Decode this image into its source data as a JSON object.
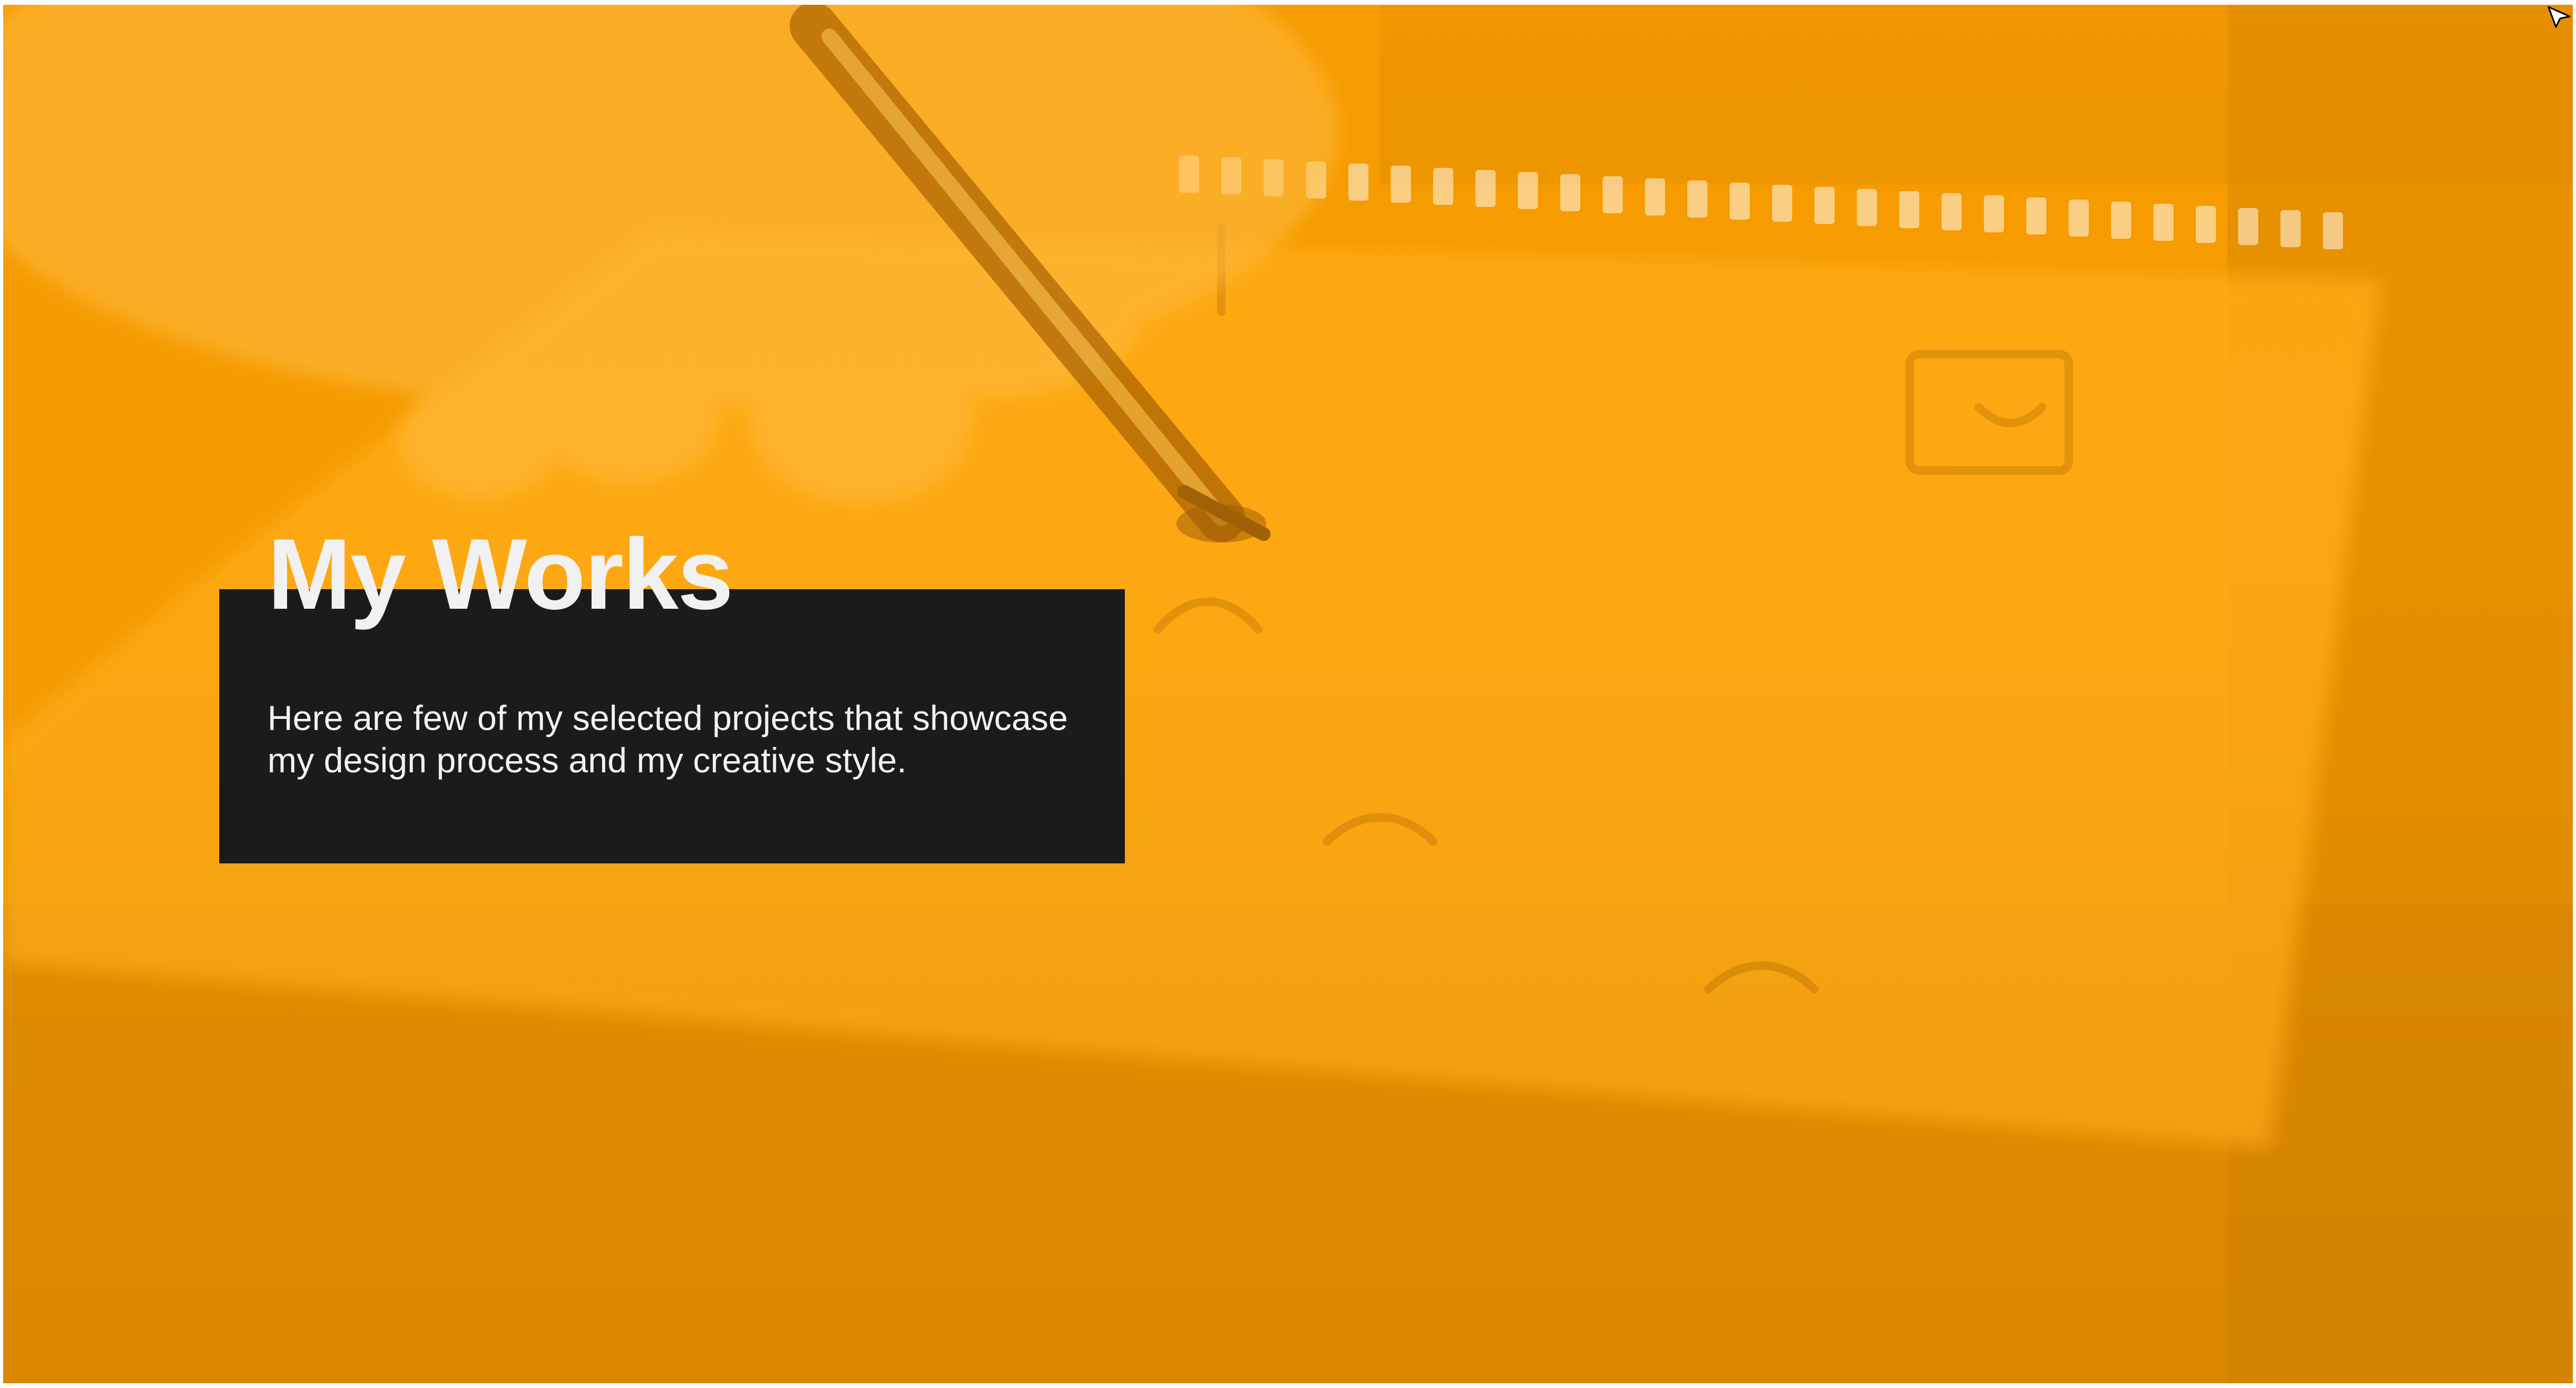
{
  "hero": {
    "background_color": "#f59b00",
    "card_color": "#1b1b1b",
    "title": "My Works",
    "subtitle": "Here are few of my selected projects that showcase my design process and my creative style."
  },
  "icons": {
    "cursor": "cursor-icon"
  }
}
